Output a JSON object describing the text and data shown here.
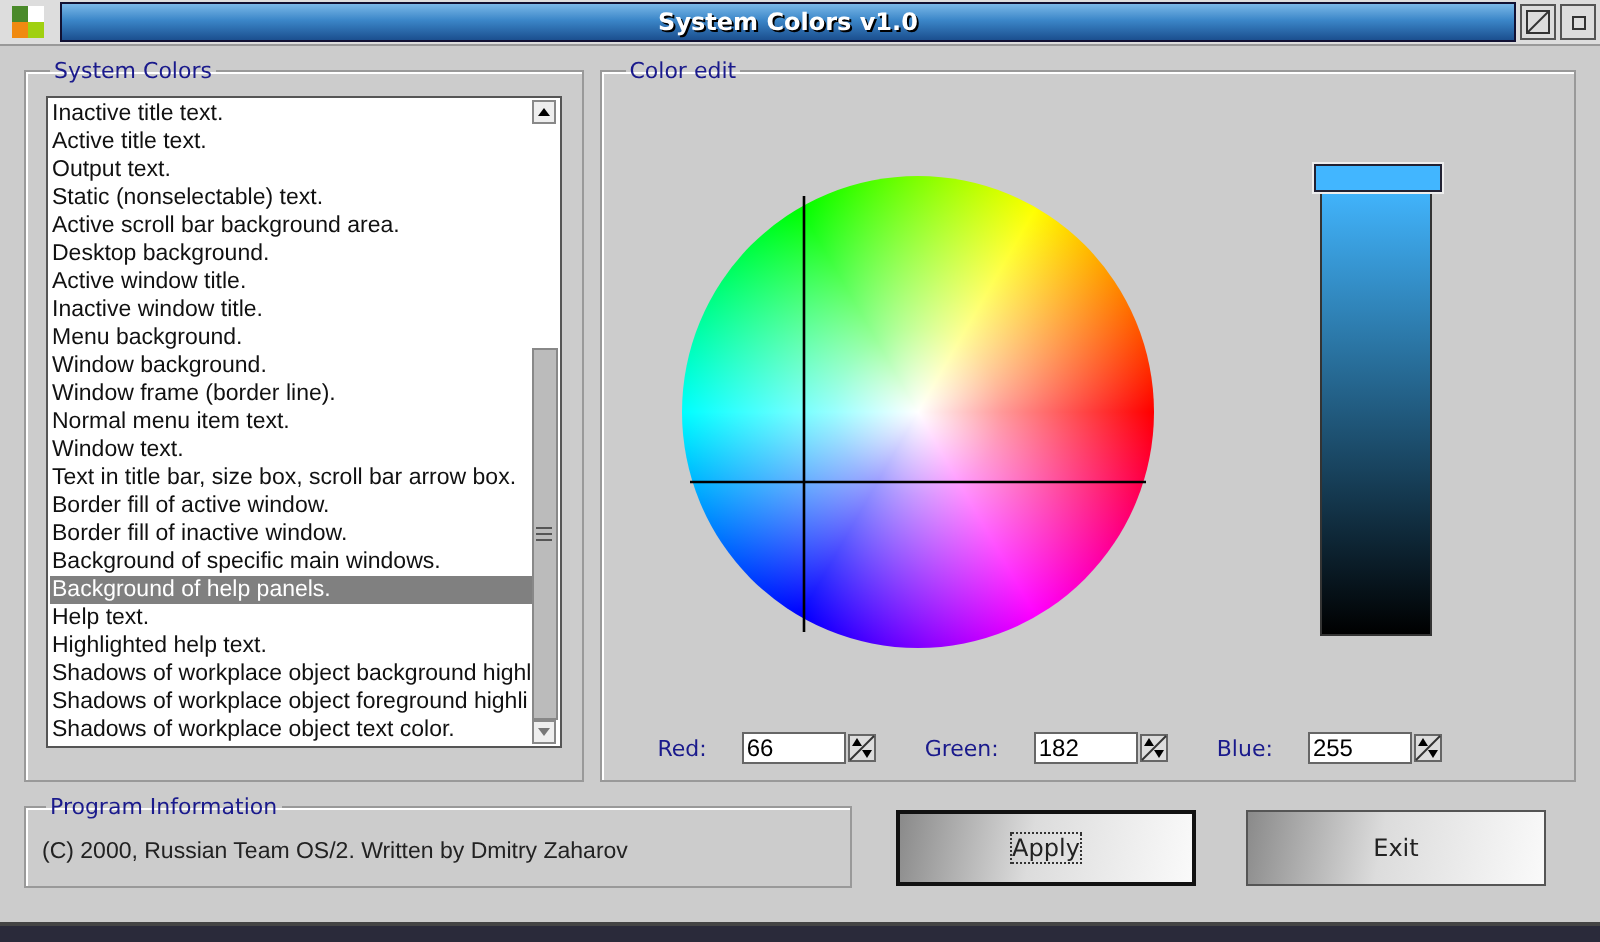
{
  "window": {
    "title": "System Colors v1.0"
  },
  "system_colors": {
    "legend": "System Colors",
    "items": [
      {
        "label": "Inactive title text.",
        "selected": false
      },
      {
        "label": "Active title text.",
        "selected": false
      },
      {
        "label": "Output text.",
        "selected": false
      },
      {
        "label": "Static (nonselectable) text.",
        "selected": false
      },
      {
        "label": "Active scroll bar background area.",
        "selected": false
      },
      {
        "label": "Desktop background.",
        "selected": false
      },
      {
        "label": "Active window title.",
        "selected": false
      },
      {
        "label": "Inactive window title.",
        "selected": false
      },
      {
        "label": "Menu background.",
        "selected": false
      },
      {
        "label": "Window background.",
        "selected": false
      },
      {
        "label": "Window frame (border line).",
        "selected": false
      },
      {
        "label": "Normal menu item text.",
        "selected": false
      },
      {
        "label": "Window text.",
        "selected": false
      },
      {
        "label": "Text in title bar, size box, scroll bar arrow box.",
        "selected": false
      },
      {
        "label": "Border fill of active window.",
        "selected": false
      },
      {
        "label": "Border fill of inactive window.",
        "selected": false
      },
      {
        "label": "Background of specific main windows.",
        "selected": false
      },
      {
        "label": "Background of help panels.",
        "selected": true
      },
      {
        "label": "Help text.",
        "selected": false
      },
      {
        "label": "Highlighted help text.",
        "selected": false
      },
      {
        "label": "Shadows of workplace object background highl",
        "selected": false
      },
      {
        "label": "Shadows of workplace object foreground highli",
        "selected": false
      },
      {
        "label": "Shadows of workplace object text color.",
        "selected": false
      }
    ]
  },
  "color_edit": {
    "legend": "Color edit",
    "brightness": {
      "level": 1
    },
    "fields": [
      {
        "label": "Red:",
        "value": "66"
      },
      {
        "label": "Green:",
        "value": "182"
      },
      {
        "label": "Blue:",
        "value": "255"
      }
    ]
  },
  "program_information": {
    "legend": "Program Information",
    "text": "(C) 2000, Russian Team OS/2. Written by Dmitry Zaharov"
  },
  "buttons": [
    {
      "label": "Apply",
      "focused": true
    },
    {
      "label": "Exit",
      "focused": false
    }
  ]
}
